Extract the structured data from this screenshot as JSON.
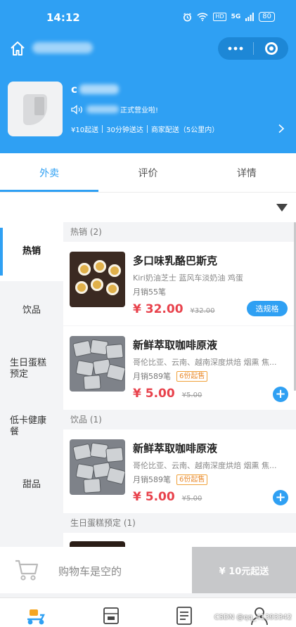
{
  "status_bar": {
    "time": "14:12",
    "battery": "80",
    "network": "HD",
    "signal": "5G"
  },
  "shop": {
    "name_prefix": "c",
    "notice_suffix": "正式营业啦!",
    "min_order": "¥10起送",
    "delivery_time": "30分钟送达",
    "delivery_mode": "商家配送（5公里内）"
  },
  "tabs": [
    {
      "label": "外卖",
      "active": true
    },
    {
      "label": "评价",
      "active": false
    },
    {
      "label": "详情",
      "active": false
    }
  ],
  "categories": [
    {
      "label": "热销",
      "active": true
    },
    {
      "label": "饮品",
      "active": false
    },
    {
      "label": "生日蛋糕预定",
      "active": false
    },
    {
      "label": "低卡健康餐",
      "active": false
    },
    {
      "label": "甜品",
      "active": false
    }
  ],
  "sections": [
    {
      "title": "热销 (2)"
    },
    {
      "title": "饮品 (1)"
    },
    {
      "title": "生日蛋糕预定 (1)"
    }
  ],
  "items": [
    {
      "name": "多口味乳酪巴斯克",
      "desc": "Kiri奶油芝士 蓝风车淡奶油 鸡蛋",
      "sales": "月销55笔",
      "price": "¥ 32.00",
      "old_price": "¥32.00",
      "action": "选规格"
    },
    {
      "name": "新鲜萃取咖啡原液",
      "desc": "哥伦比亚、云南、越南深度烘焙 烟熏 焦...",
      "sales": "月销589笔",
      "badge": "6份起售",
      "price": "¥ 5.00",
      "old_price": "¥5.00",
      "action": "+"
    },
    {
      "name": "新鲜萃取咖啡原液",
      "desc": "哥伦比亚、云南、越南深度烘焙 烟熏 焦...",
      "sales": "月销589笔",
      "badge": "6份起售",
      "price": "¥ 5.00",
      "old_price": "¥5.00",
      "action": "+"
    }
  ],
  "cart": {
    "empty_text": "购物车是空的",
    "checkout_label": "¥ 10元起送"
  },
  "bottom_nav": [
    "scooter-icon",
    "vip-card-icon",
    "order-list-icon",
    "profile-icon"
  ],
  "watermark": "CSDN @qq_41393342",
  "colors": {
    "primary": "#2fa0f3",
    "price": "#e8424c",
    "badge": "#f0a13a",
    "checkout_disabled": "#c7c8ca"
  }
}
